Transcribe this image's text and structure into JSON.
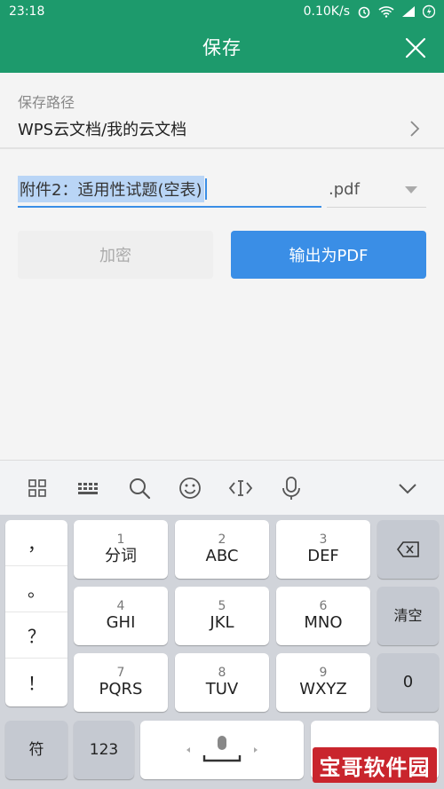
{
  "status_bar": {
    "time": "23:18",
    "speed": "0.10K/s",
    "icons": [
      "alarm-icon",
      "wifi-icon",
      "signal-icon",
      "battery-charging-icon"
    ]
  },
  "header": {
    "title": "保存",
    "close_icon": "close-icon",
    "background": "#1d9a6c"
  },
  "save_path": {
    "label": "保存路径",
    "value": "WPS云文档/我的云文档"
  },
  "filename": {
    "value": "附件2：适用性试题(空表)"
  },
  "extension": {
    "selected": ".pdf"
  },
  "buttons": {
    "encrypt": "加密",
    "export": "输出为PDF",
    "accent": "#3a8ee6"
  },
  "keyboard_toolbar": {
    "icons": [
      "grid-icon",
      "keyboard-icon",
      "search-icon",
      "emoji-icon",
      "text-cursor-icon",
      "microphone-icon",
      "chevron-down-icon"
    ]
  },
  "keyboard": {
    "symbols": [
      "，",
      "。",
      "？",
      "！"
    ],
    "keys": [
      {
        "num": "1",
        "label": "分词"
      },
      {
        "num": "2",
        "label": "ABC"
      },
      {
        "num": "3",
        "label": "DEF"
      },
      {
        "num": "4",
        "label": "GHI"
      },
      {
        "num": "5",
        "label": "JKL"
      },
      {
        "num": "6",
        "label": "MNO"
      },
      {
        "num": "7",
        "label": "PQRS"
      },
      {
        "num": "8",
        "label": "TUV"
      },
      {
        "num": "9",
        "label": "WXYZ"
      }
    ],
    "clear": "清空",
    "zero": "0",
    "symbol_key": "符",
    "num_key": "123"
  },
  "watermark": {
    "text": "宝哥软件园"
  }
}
